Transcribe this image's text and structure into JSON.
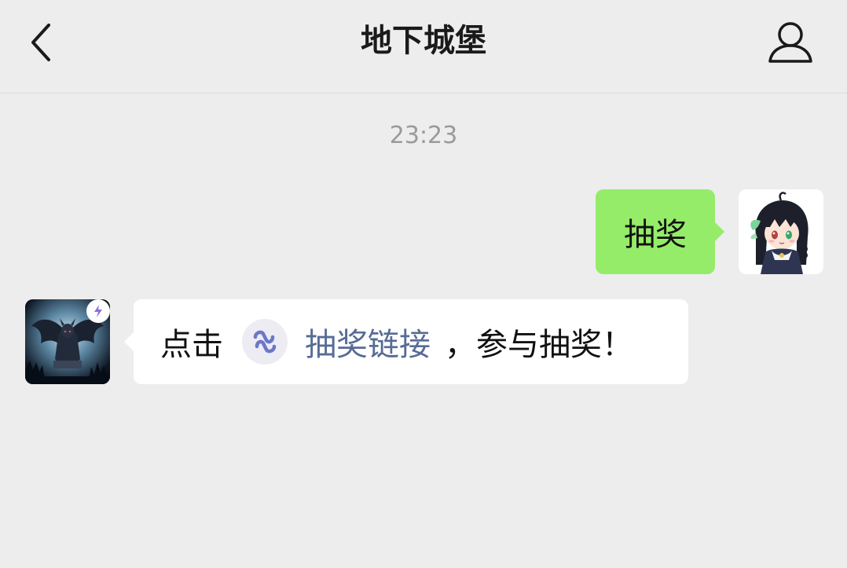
{
  "header": {
    "title": "地下城堡",
    "back_icon": "chevron-left-icon",
    "profile_icon": "person-outline-icon"
  },
  "chat": {
    "timestamp": "23:23",
    "messages": [
      {
        "sender": "self",
        "text": "抽奖",
        "bubble_color": "#95ec69"
      },
      {
        "sender": "other",
        "prefix": "点击",
        "link_text": "抽奖链接",
        "suffix": "，参与抽奖！",
        "link_color": "#576b95",
        "link_icon": "mini-program-icon"
      }
    ]
  },
  "colors": {
    "background": "#ededed",
    "self_bubble": "#95ec69",
    "other_bubble": "#ffffff",
    "link": "#576b95",
    "timestamp": "#9a9a9a"
  }
}
